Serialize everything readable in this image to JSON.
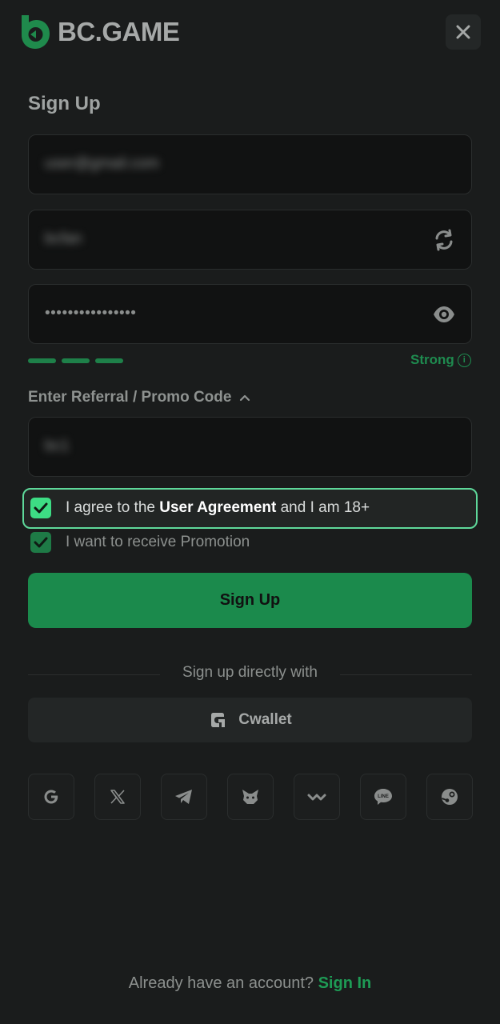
{
  "header": {
    "brand": "BC.GAME",
    "close_icon": "close-icon"
  },
  "form": {
    "title": "Sign Up",
    "email_value": "user@gmail.com",
    "username_value": "bcfan",
    "refresh_icon": "refresh-icon",
    "password_value": "••••••••••••••••",
    "eye_icon": "eye-icon",
    "strength_label": "Strong",
    "strength_level": 1.0,
    "info_icon": "info-icon",
    "promo_label": "Enter Referral / Promo Code",
    "promo_value": "bc1",
    "agree_prefix": "I agree to the ",
    "agree_link": "User Agreement",
    "agree_suffix": " and I am 18+",
    "agree_checked": true,
    "promotion_label": "I want to receive Promotion",
    "promotion_checked": true,
    "submit_label": "Sign Up"
  },
  "social": {
    "divider_text": "Sign up directly with",
    "cwallet_label": "Cwallet",
    "providers": [
      "google-icon",
      "x-icon",
      "telegram-icon",
      "metamask-icon",
      "walletconnect-icon",
      "line-icon",
      "steam-icon"
    ]
  },
  "footer": {
    "prompt": "Already have an account? ",
    "link": "Sign In"
  },
  "colors": {
    "background": "#1a1c1c",
    "accent": "#1b8a4c",
    "highlight": "#5ed89a"
  }
}
